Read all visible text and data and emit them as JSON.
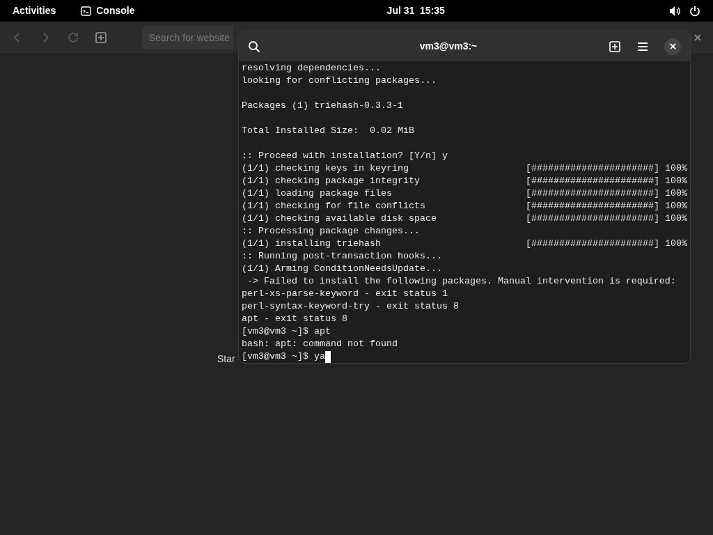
{
  "top_bar": {
    "activities": "Activities",
    "app_name": "Console",
    "clock": "Jul 31  15:35"
  },
  "browser": {
    "search": {
      "placeholder": "Search for website"
    },
    "page_text": "Star"
  },
  "terminal": {
    "title": "vm3@vm3:~",
    "lines": [
      {
        "kind": "plain",
        "text": "resolving dependencies..."
      },
      {
        "kind": "plain",
        "text": "looking for conflicting packages..."
      },
      {
        "kind": "blank"
      },
      {
        "kind": "plain",
        "text": "Packages (1) triehash-0.3.3-1"
      },
      {
        "kind": "blank"
      },
      {
        "kind": "plain",
        "text": "Total Installed Size:  0.02 MiB"
      },
      {
        "kind": "blank"
      },
      {
        "kind": "plain",
        "text": ":: Proceed with installation? [Y/n] y"
      },
      {
        "kind": "progress",
        "text": "(1/1) checking keys in keyring",
        "bar": "[######################]",
        "percent": "100%"
      },
      {
        "kind": "progress",
        "text": "(1/1) checking package integrity",
        "bar": "[######################]",
        "percent": "100%"
      },
      {
        "kind": "progress",
        "text": "(1/1) loading package files",
        "bar": "[######################]",
        "percent": "100%"
      },
      {
        "kind": "progress",
        "text": "(1/1) checking for file conflicts",
        "bar": "[######################]",
        "percent": "100%"
      },
      {
        "kind": "progress",
        "text": "(1/1) checking available disk space",
        "bar": "[######################]",
        "percent": "100%"
      },
      {
        "kind": "plain",
        "text": ":: Processing package changes..."
      },
      {
        "kind": "progress",
        "text": "(1/1) installing triehash",
        "bar": "[######################]",
        "percent": "100%"
      },
      {
        "kind": "plain",
        "text": ":: Running post-transaction hooks..."
      },
      {
        "kind": "plain",
        "text": "(1/1) Arming ConditionNeedsUpdate..."
      },
      {
        "kind": "plain",
        "text": " -> Failed to install the following packages. Manual intervention is required:"
      },
      {
        "kind": "plain",
        "text": "perl-xs-parse-keyword - exit status 1"
      },
      {
        "kind": "plain",
        "text": "perl-syntax-keyword-try - exit status 8"
      },
      {
        "kind": "plain",
        "text": "apt - exit status 8"
      },
      {
        "kind": "plain",
        "text": "[vm3@vm3 ~]$ apt"
      },
      {
        "kind": "plain",
        "text": "bash: apt: command not found"
      },
      {
        "kind": "prompt",
        "text": "[vm3@vm3 ~]$ ya"
      }
    ]
  }
}
